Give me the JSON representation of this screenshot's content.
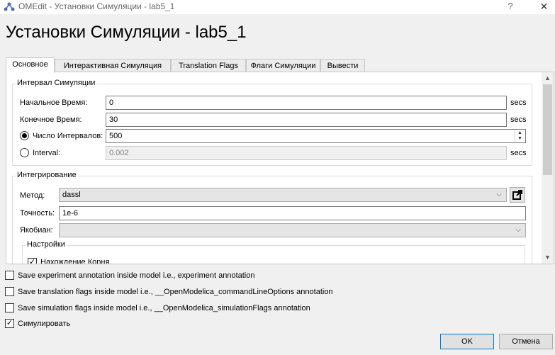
{
  "window": {
    "title": "OMEdit - Установки Симуляции - lab5_1",
    "help_label": "?",
    "close_label": "✕"
  },
  "heading": "Установки Симуляции - lab5_1",
  "tabs": [
    {
      "label": "Основное",
      "active": true
    },
    {
      "label": "Интерактивная Симуляция",
      "active": false
    },
    {
      "label": "Translation Flags",
      "active": false
    },
    {
      "label": "Флаги Симуляции",
      "active": false
    },
    {
      "label": "Вывести",
      "active": false
    }
  ],
  "interval": {
    "title": "Интервал Симуляции",
    "start_label": "Начальное Время:",
    "start_value": "0",
    "stop_label": "Конечное Время:",
    "stop_value": "30",
    "intervals_label": "Число Интервалов:",
    "intervals_value": "500",
    "interval_label": "Interval:",
    "interval_value": "0.002",
    "unit": "secs"
  },
  "integration": {
    "title": "Интегрирование",
    "method_label": "Метод:",
    "method_value": "dassl",
    "tolerance_label": "Точность:",
    "tolerance_value": "1e-6",
    "jacobian_label": "Якобиан:",
    "jacobian_value": "",
    "settings_title": "Настройки",
    "root_finding_label": "Нахождение Корня"
  },
  "options": [
    {
      "label": "Save experiment annotation inside model i.e., experiment annotation",
      "checked": false
    },
    {
      "label": "Save translation flags inside model i.e., __OpenModelica_commandLineOptions annotation",
      "checked": false
    },
    {
      "label": "Save simulation flags inside model i.e., __OpenModelica_simulationFlags annotation",
      "checked": false
    },
    {
      "label": "Симулировать",
      "checked": true
    }
  ],
  "buttons": {
    "ok": "OK",
    "cancel": "Отмена"
  },
  "icons": {
    "app": "omedit-app-icon",
    "external": "external-window-icon"
  },
  "colors": {
    "accent": "#0078d7"
  }
}
